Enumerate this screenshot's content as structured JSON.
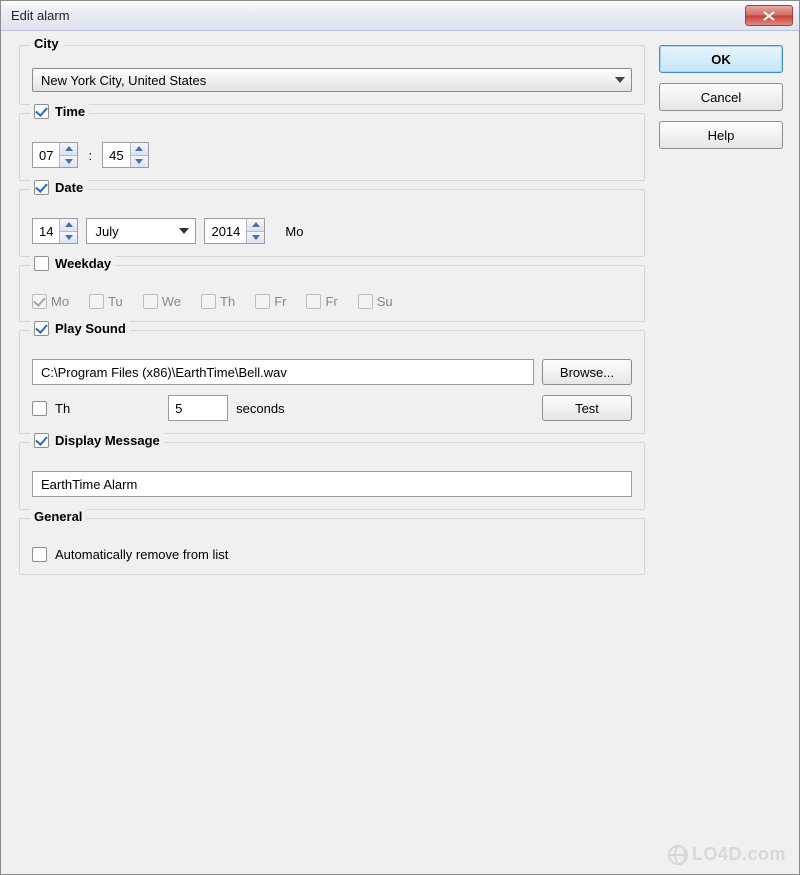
{
  "title": "Edit alarm",
  "buttons": {
    "ok": "OK",
    "cancel": "Cancel",
    "help": "Help",
    "browse": "Browse...",
    "test": "Test"
  },
  "city": {
    "label": "City",
    "value": "New York City, United States"
  },
  "time": {
    "label": "Time",
    "checked": true,
    "hh": "07",
    "mm": "45"
  },
  "date": {
    "label": "Date",
    "checked": true,
    "day": "14",
    "month": "July",
    "year": "2014",
    "weekday": "Mo"
  },
  "weekday": {
    "label": "Weekday",
    "checked": false,
    "days": [
      {
        "label": "Mo",
        "checked": true
      },
      {
        "label": "Tu",
        "checked": false
      },
      {
        "label": "We",
        "checked": false
      },
      {
        "label": "Th",
        "checked": false
      },
      {
        "label": "Fr",
        "checked": false
      },
      {
        "label": "Fr",
        "checked": false
      },
      {
        "label": "Su",
        "checked": false
      }
    ]
  },
  "sound": {
    "label": "Play Sound",
    "checked": true,
    "path": "C:\\Program Files (x86)\\EarthTime\\Bell.wav",
    "repeat_checked": false,
    "repeat_label": "Th",
    "seconds_value": "5",
    "seconds_label": "seconds"
  },
  "message": {
    "label": "Display Message",
    "checked": true,
    "value": "EarthTime Alarm"
  },
  "general": {
    "label": "General",
    "auto_remove_checked": false,
    "auto_remove_label": "Automatically remove from list"
  },
  "watermark": "LO4D.com"
}
